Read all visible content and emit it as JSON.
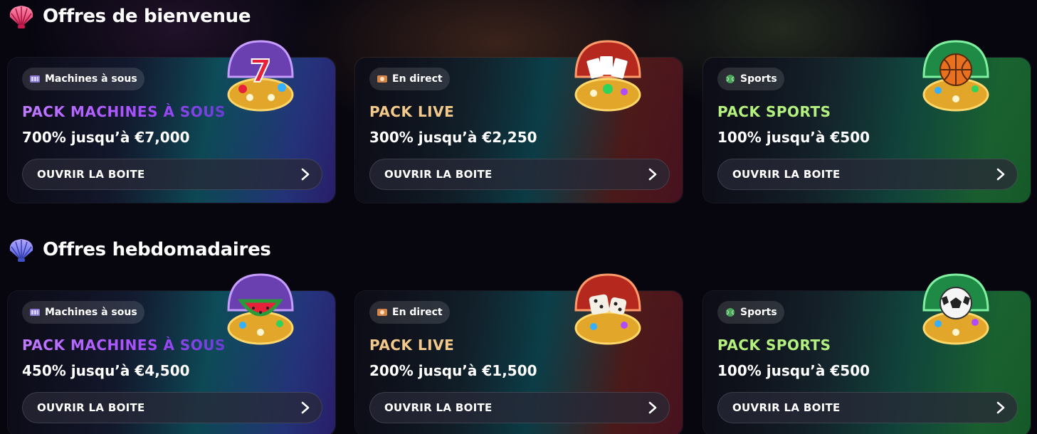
{
  "sections": [
    {
      "title": "Offres de bienvenue",
      "icon": "pink-shell-icon",
      "cards": [
        {
          "category": "Machines à sous",
          "category_icon": "slot-machine-icon",
          "pack": "PACK MACHINES À SOUS",
          "offer": "700% jusqu’à €7,000",
          "button": "OUVRIR LA BOITE",
          "art": "lucky-seven-chest"
        },
        {
          "category": "En direct",
          "category_icon": "live-ticket-icon",
          "pack": "PACK LIVE",
          "offer": "300% jusqu’à €2,250",
          "button": "OUVRIR LA BOITE",
          "art": "playing-cards-chest"
        },
        {
          "category": "Sports",
          "category_icon": "tennis-ball-icon",
          "pack": "PACK SPORTS",
          "offer": "100% jusqu’à €500",
          "button": "OUVRIR LA BOITE",
          "art": "basketball-chest"
        }
      ]
    },
    {
      "title": "Offres hebdomadaires",
      "icon": "blue-shell-icon",
      "cards": [
        {
          "category": "Machines à sous",
          "category_icon": "slot-machine-icon",
          "pack": "PACK MACHINES À SOUS",
          "offer": "450% jusqu’à €4,500",
          "button": "OUVRIR LA BOITE",
          "art": "watermelon-chest"
        },
        {
          "category": "En direct",
          "category_icon": "live-ticket-icon",
          "pack": "PACK LIVE",
          "offer": "200% jusqu’à €1,500",
          "button": "OUVRIR LA BOITE",
          "art": "dice-chest"
        },
        {
          "category": "Sports",
          "category_icon": "tennis-ball-icon",
          "pack": "PACK SPORTS",
          "offer": "100% jusqu’à €500",
          "button": "OUVRIR LA BOITE",
          "art": "soccer-ball-chest"
        }
      ]
    }
  ],
  "colors": {
    "slots_title": "#a64dff",
    "live_title": "#f2c98a",
    "sports_title": "#b4f07e",
    "background": "#07060f"
  }
}
